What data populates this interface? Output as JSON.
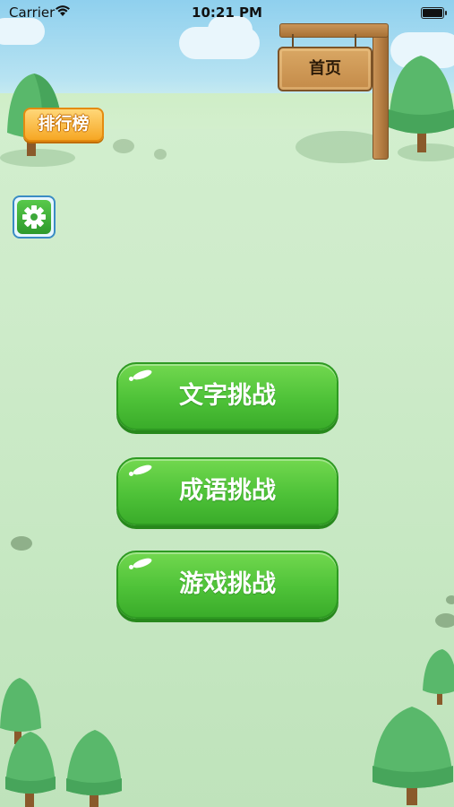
{
  "status_bar": {
    "carrier": "Carrier",
    "time": "10:21 PM",
    "wifi_icon": "wifi-icon",
    "battery_icon": "battery-icon"
  },
  "signboard": {
    "label": "首页"
  },
  "rank_button": {
    "label": "排行榜"
  },
  "settings_button": {
    "icon": "gear-icon"
  },
  "challenges": [
    {
      "label": "文字挑战"
    },
    {
      "label": "成语挑战"
    },
    {
      "label": "游戏挑战"
    }
  ],
  "colors": {
    "button_green": "#4ec238",
    "rank_orange": "#f6a724",
    "sky_blue": "#8fd0ee",
    "grass": "#cfeccb"
  }
}
